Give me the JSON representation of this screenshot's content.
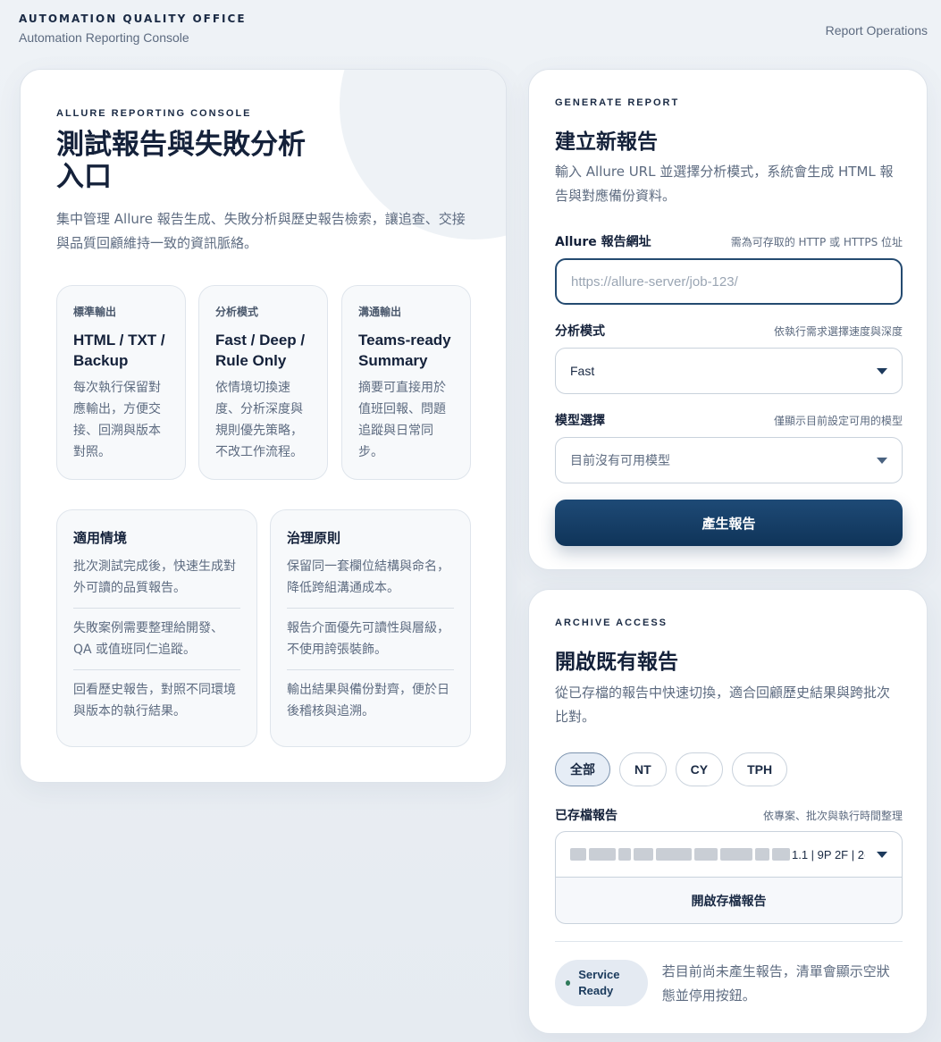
{
  "header": {
    "org": "AUTOMATION QUALITY OFFICE",
    "subtitle": "Automation Reporting Console",
    "right_link": "Report Operations"
  },
  "hero": {
    "eyebrow": "ALLURE REPORTING CONSOLE",
    "title": "測試報告與失敗分析入口",
    "description": "集中管理 Allure 報告生成、失敗分析與歷史報告檢索，讓追查、交接與品質回顧維持一致的資訊脈絡。"
  },
  "features": [
    {
      "label": "標準輸出",
      "title": "HTML / TXT / Backup",
      "desc": "每次執行保留對應輸出，方便交接、回溯與版本對照。"
    },
    {
      "label": "分析模式",
      "title": "Fast / Deep / Rule Only",
      "desc": "依情境切換速度、分析深度與規則優先策略，不改工作流程。"
    },
    {
      "label": "溝通輸出",
      "title": "Teams-ready Summary",
      "desc": "摘要可直接用於值班回報、問題追蹤與日常同步。"
    }
  ],
  "panels": [
    {
      "title": "適用情境",
      "items": [
        "批次測試完成後，快速生成對外可讀的品質報告。",
        "失敗案例需要整理給開發、QA 或值班同仁追蹤。",
        "回看歷史報告，對照不同環境與版本的執行結果。"
      ]
    },
    {
      "title": "治理原則",
      "items": [
        "保留同一套欄位結構與命名，降低跨組溝通成本。",
        "報告介面優先可讀性與層級，不使用誇張裝飾。",
        "輸出結果與備份對齊，便於日後稽核與追溯。"
      ]
    }
  ],
  "generate": {
    "eyebrow": "GENERATE REPORT",
    "title": "建立新報告",
    "description": "輸入 Allure URL 並選擇分析模式，系統會生成 HTML 報告與對應備份資料。",
    "url_label": "Allure 報告網址",
    "url_hint": "需為可存取的 HTTP 或 HTTPS 位址",
    "url_placeholder": "https://allure-server/job-123/",
    "mode_label": "分析模式",
    "mode_hint": "依執行需求選擇速度與深度",
    "mode_value": "Fast",
    "model_label": "模型選擇",
    "model_hint": "僅顯示目前設定可用的模型",
    "model_value": "目前沒有可用模型",
    "submit": "產生報告"
  },
  "archive": {
    "eyebrow": "ARCHIVE ACCESS",
    "title": "開啟既有報告",
    "description": "從已存檔的報告中快速切換，適合回顧歷史結果與跨批次比對。",
    "filters": [
      "全部",
      "NT",
      "CY",
      "TPH"
    ],
    "active_filter": "全部",
    "select_label": "已存檔報告",
    "select_hint": "依專案、批次與執行時間整理",
    "select_value_tail": "1.1 | 9P 2F | 2(",
    "open_button": "開啟存檔報告",
    "status": "Service Ready",
    "empty_note": "若目前尚未產生報告，清單會顯示空狀態並停用按鈕。"
  }
}
